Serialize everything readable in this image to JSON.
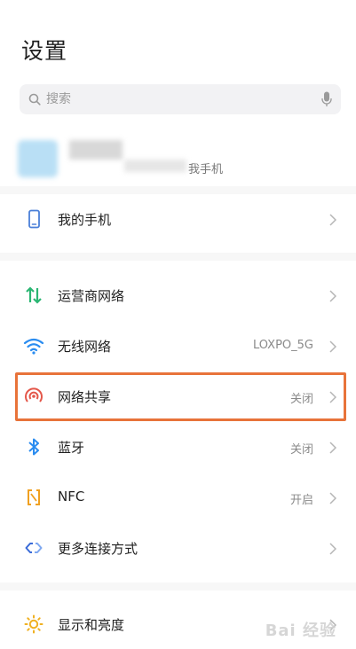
{
  "header": {
    "title": "设置"
  },
  "search": {
    "placeholder": "搜索"
  },
  "account": {
    "text": "我手机"
  },
  "rows": [
    {
      "label": "我的手机",
      "value": ""
    },
    {
      "label": "运营商网络",
      "value": ""
    },
    {
      "label": "无线网络",
      "value": "LOXPO_5G"
    },
    {
      "label": "网络共享",
      "value": "关闭"
    },
    {
      "label": "蓝牙",
      "value": "关闭"
    },
    {
      "label": "NFC",
      "value": "开启"
    },
    {
      "label": "更多连接方式",
      "value": ""
    },
    {
      "label": "显示和亮度",
      "value": ""
    }
  ],
  "colors": {
    "accent_highlight": "#e8733a",
    "signal_green": "#2bb673",
    "wifi_blue": "#2a8cf0",
    "hotspot_red": "#e4574a",
    "nfc_orange": "#f0a020"
  },
  "watermark": {
    "text": "Bai 经验"
  }
}
